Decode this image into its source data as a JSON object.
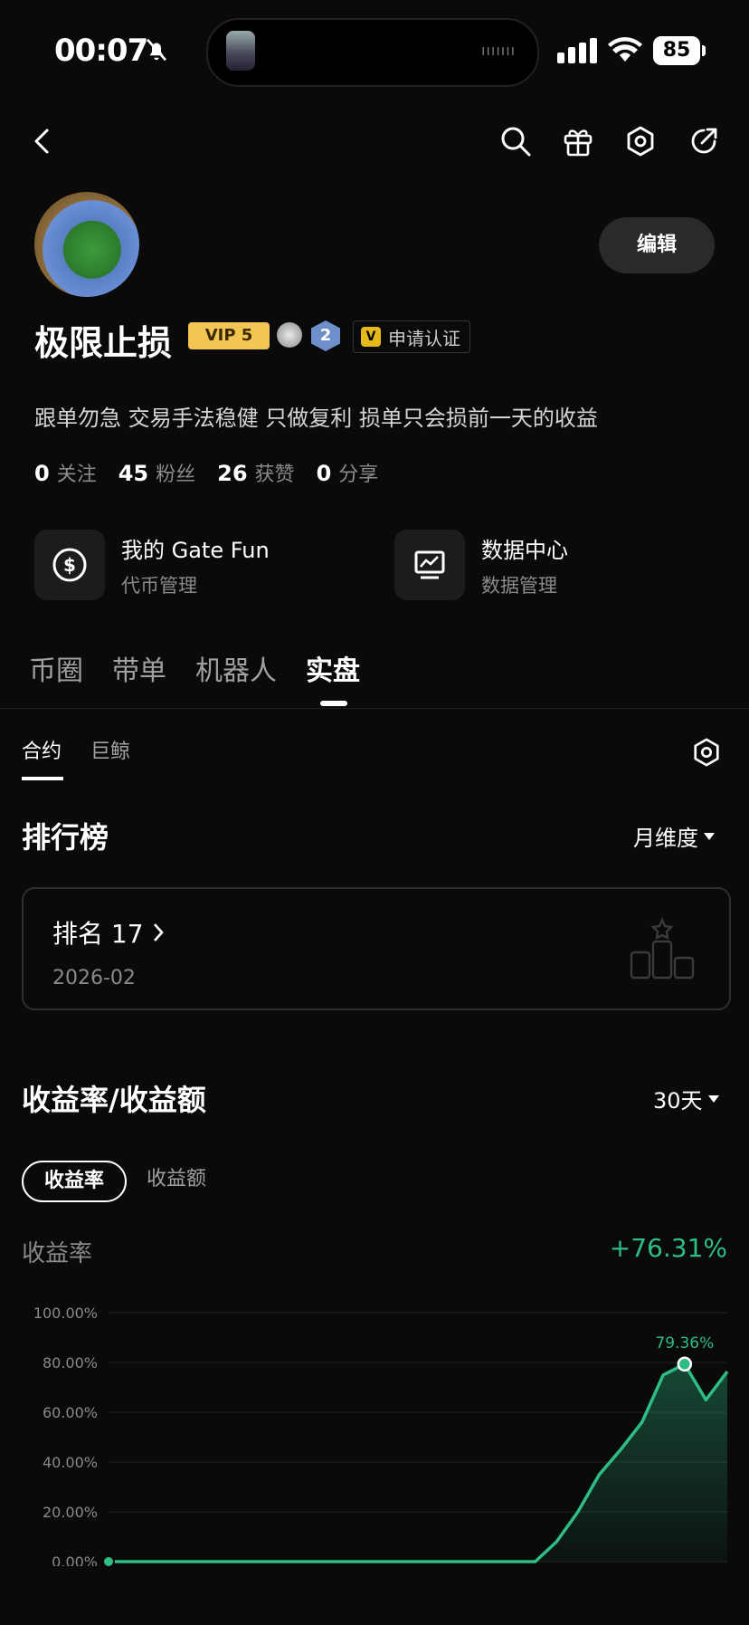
{
  "status": {
    "time": "00:07",
    "battery": "85",
    "island_dots": "ııııııı"
  },
  "header": {
    "edit_label": "编辑"
  },
  "profile": {
    "name": "极限止损",
    "vip": "VIP 5",
    "level_badge": "2",
    "verify_v": "V",
    "verify_label": "申请认证",
    "bio": "跟单勿急 交易手法稳健 只做复利 损单只会损前一天的收益"
  },
  "stats": [
    {
      "value": "0",
      "label": "关注"
    },
    {
      "value": "45",
      "label": "粉丝"
    },
    {
      "value": "26",
      "label": "获赞"
    },
    {
      "value": "0",
      "label": "分享"
    }
  ],
  "cards": [
    {
      "title": "我的 Gate Fun",
      "subtitle": "代币管理"
    },
    {
      "title": "数据中心",
      "subtitle": "数据管理"
    }
  ],
  "main_tabs": [
    "币圈",
    "带单",
    "机器人",
    "实盘"
  ],
  "sub_tabs": [
    "合约",
    "巨鲸"
  ],
  "ranking": {
    "title": "排行榜",
    "period": "月维度",
    "rank_label": "排名 17",
    "rank_date": "2026-02"
  },
  "returns": {
    "title": "收益率/收益额",
    "period": "30天",
    "pill_rate": "收益率",
    "pill_amount": "收益额",
    "metric_label": "收益率",
    "metric_value": "+76.31%"
  },
  "colors": {
    "accent_green": "#2ebd85",
    "vip_gold": "#f3c552",
    "background": "#0a0a0a"
  },
  "chart_data": {
    "type": "area",
    "y_ticks": [
      "100.00%",
      "80.00%",
      "60.00%",
      "40.00%",
      "20.00%",
      "0.00%"
    ],
    "ylim": [
      0,
      100
    ],
    "x": [
      1,
      2,
      3,
      4,
      5,
      6,
      7,
      8,
      9,
      10,
      11,
      12,
      13,
      14,
      15,
      16,
      17,
      18,
      19,
      20,
      21,
      22,
      23,
      24,
      25,
      26,
      27,
      28,
      29,
      30
    ],
    "series": [
      {
        "values": [
          0,
          0,
          0,
          0,
          0,
          0,
          0,
          0,
          0,
          0,
          0,
          0,
          0,
          0,
          0,
          0,
          0,
          0,
          0,
          0,
          0,
          8,
          20,
          35,
          45,
          56,
          75,
          79.36,
          65,
          76.31
        ]
      }
    ],
    "peak_label": "79.36%",
    "grid": true,
    "color": "#2ebd85"
  }
}
